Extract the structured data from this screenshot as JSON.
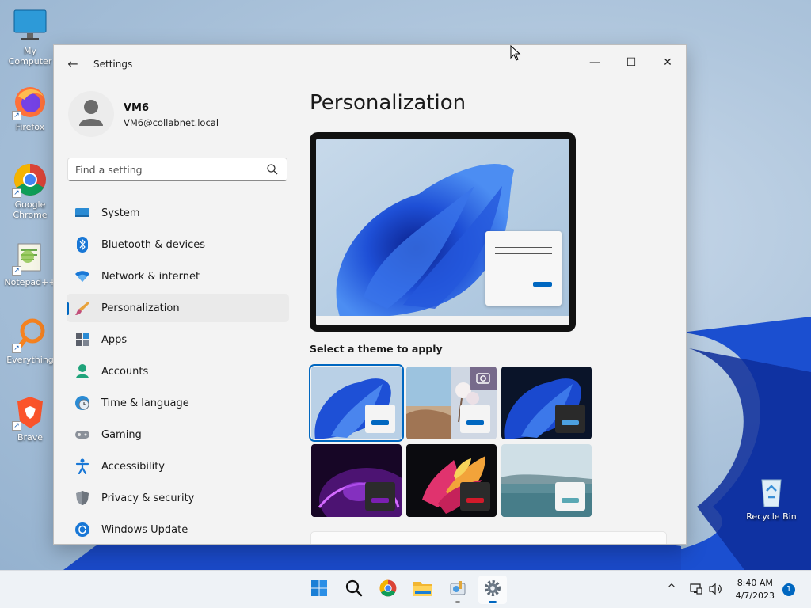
{
  "desktop": {
    "icons": [
      {
        "label": "My Computer",
        "icon": "monitor-icon"
      },
      {
        "label": "Firefox",
        "icon": "firefox-icon"
      },
      {
        "label": "Google Chrome",
        "icon": "chrome-icon"
      },
      {
        "label": "Notepad++",
        "icon": "notepadpp-icon"
      },
      {
        "label": "Everything",
        "icon": "everything-search-icon"
      },
      {
        "label": "Brave",
        "icon": "brave-icon"
      },
      {
        "label": "Recycle Bin",
        "icon": "recycle-bin-icon"
      }
    ]
  },
  "window": {
    "title": "Settings",
    "controls": {
      "minimize": "—",
      "maximize": "☐",
      "close": "✕"
    },
    "back": "←"
  },
  "profile": {
    "name": "VM6",
    "email": "VM6@collabnet.local"
  },
  "search": {
    "placeholder": "Find a setting"
  },
  "nav": {
    "items": [
      {
        "label": "System",
        "icon": "system-icon"
      },
      {
        "label": "Bluetooth & devices",
        "icon": "bluetooth-icon"
      },
      {
        "label": "Network & internet",
        "icon": "wifi-icon"
      },
      {
        "label": "Personalization",
        "icon": "brush-icon",
        "active": true
      },
      {
        "label": "Apps",
        "icon": "apps-icon"
      },
      {
        "label": "Accounts",
        "icon": "accounts-icon"
      },
      {
        "label": "Time & language",
        "icon": "time-language-icon"
      },
      {
        "label": "Gaming",
        "icon": "gamepad-icon"
      },
      {
        "label": "Accessibility",
        "icon": "accessibility-icon"
      },
      {
        "label": "Privacy & security",
        "icon": "shield-icon"
      },
      {
        "label": "Windows Update",
        "icon": "update-icon"
      }
    ]
  },
  "main": {
    "title": "Personalization",
    "theme_heading": "Select a theme to apply",
    "themes": [
      {
        "name": "windows-light",
        "selected": true
      },
      {
        "name": "windows-spotlight"
      },
      {
        "name": "windows-dark"
      },
      {
        "name": "glow"
      },
      {
        "name": "captured-motion"
      },
      {
        "name": "flow"
      }
    ]
  },
  "taskbar": {
    "apps": [
      "start-icon",
      "search-icon",
      "chrome-icon",
      "file-explorer-icon",
      "control-panel-icon",
      "settings-icon"
    ],
    "tray_chevron": "^",
    "time": "8:40 AM",
    "date": "4/7/2023",
    "notifications": "1"
  },
  "colors": {
    "accent": "#0067c0"
  }
}
